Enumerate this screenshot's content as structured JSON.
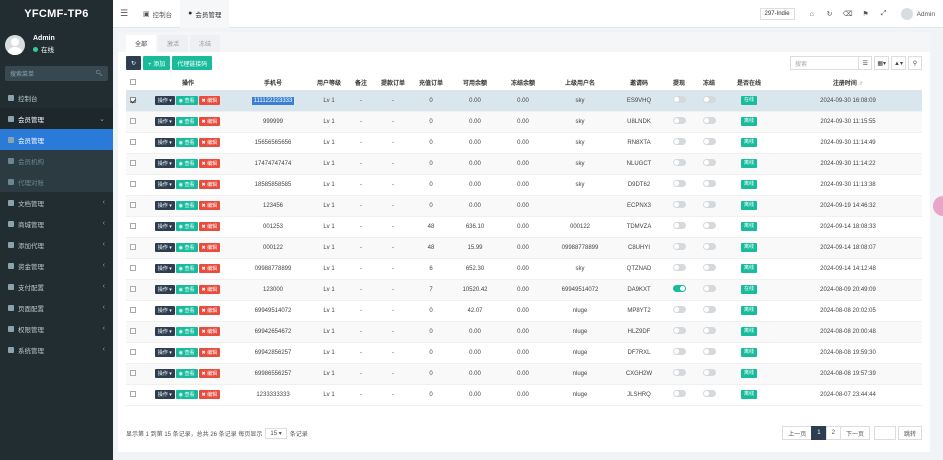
{
  "app": {
    "logo": "YFCMF-TP6"
  },
  "profile": {
    "name": "Admin",
    "status": "在线"
  },
  "sidebar": {
    "search_placeholder": "搜索菜单",
    "items": [
      {
        "label": "控制台",
        "state": "normal"
      },
      {
        "label": "会员管理",
        "state": "open"
      },
      {
        "label": "会员管理",
        "state": "active"
      },
      {
        "label": "会员机构",
        "state": "sub"
      },
      {
        "label": "代理对账",
        "state": "sub"
      },
      {
        "label": "文档管理",
        "state": "normal"
      },
      {
        "label": "商城管理",
        "state": "normal"
      },
      {
        "label": "添加代理",
        "state": "normal"
      },
      {
        "label": "资金管理",
        "state": "normal"
      },
      {
        "label": "支付配置",
        "state": "normal"
      },
      {
        "label": "页面配置",
        "state": "normal"
      },
      {
        "label": "权限管理",
        "state": "normal"
      },
      {
        "label": "系统管理",
        "state": "normal"
      }
    ]
  },
  "topbar": {
    "tabs": [
      {
        "label": "控制台"
      },
      {
        "label": "会员管理"
      }
    ],
    "badge": "297-Indie",
    "user": "Admin"
  },
  "subtabs": [
    "全部",
    "激活",
    "冻结"
  ],
  "toolbar": {
    "add": "+ 添加",
    "agent_code": "代理链接码",
    "search_placeholder": "搜索"
  },
  "table": {
    "columns": [
      "操作",
      "手机号",
      "用户等级",
      "备注",
      "提款订单",
      "充值订单",
      "可用余额",
      "冻结余额",
      "上级用户名",
      "邀请码",
      "提现",
      "冻结",
      "是否在线",
      "注册时间"
    ],
    "op_labels": {
      "menu": "操作",
      "edit": "查看",
      "del": "编辑"
    },
    "rows": [
      {
        "phone": "111122223333",
        "level": "Lv 1",
        "note": "-",
        "withdraw": "-",
        "recharge": "0",
        "balance": "0.00",
        "frozen": "0.00",
        "parent": "sky",
        "invite": "ES9VHQ",
        "wd_on": false,
        "fr_on": false,
        "online": "在线",
        "time": "2024-09-30 16:08:09",
        "checked": true,
        "highlight": true
      },
      {
        "phone": "999999",
        "level": "Lv 1",
        "note": "-",
        "withdraw": "-",
        "recharge": "0",
        "balance": "0.00",
        "frozen": "0.00",
        "parent": "sky",
        "invite": "U8LNDK",
        "wd_on": false,
        "fr_on": false,
        "online": "离线",
        "time": "2024-09-30 11:15:55"
      },
      {
        "phone": "15656565656",
        "level": "Lv 1",
        "note": "-",
        "withdraw": "-",
        "recharge": "0",
        "balance": "0.00",
        "frozen": "0.00",
        "parent": "sky",
        "invite": "RN8XTA",
        "wd_on": false,
        "fr_on": false,
        "online": "离线",
        "time": "2024-09-30 11:14:49"
      },
      {
        "phone": "17474747474",
        "level": "Lv 1",
        "note": "-",
        "withdraw": "-",
        "recharge": "0",
        "balance": "0.00",
        "frozen": "0.00",
        "parent": "sky",
        "invite": "NLUGCT",
        "wd_on": false,
        "fr_on": false,
        "online": "离线",
        "time": "2024-09-30 11:14:22"
      },
      {
        "phone": "18585858585",
        "level": "Lv 1",
        "note": "-",
        "withdraw": "-",
        "recharge": "0",
        "balance": "0.00",
        "frozen": "0.00",
        "parent": "sky",
        "invite": "D9DT62",
        "wd_on": false,
        "fr_on": false,
        "online": "离线",
        "time": "2024-09-30 11:13:38"
      },
      {
        "phone": "123456",
        "level": "Lv 1",
        "note": "-",
        "withdraw": "-",
        "recharge": "0",
        "balance": "0.00",
        "frozen": "0.00",
        "parent": "",
        "invite": "ECPNX3",
        "wd_on": false,
        "fr_on": false,
        "online": "离线",
        "time": "2024-09-19 14:46:32"
      },
      {
        "phone": "001253",
        "level": "Lv 1",
        "note": "-",
        "withdraw": "-",
        "recharge": "48",
        "balance": "636.10",
        "frozen": "0.00",
        "parent": "000122",
        "invite": "TDMVZA",
        "wd_on": false,
        "fr_on": false,
        "online": "离线",
        "time": "2024-09-14 18:08:33"
      },
      {
        "phone": "000122",
        "level": "Lv 1",
        "note": "-",
        "withdraw": "-",
        "recharge": "48",
        "balance": "15.99",
        "frozen": "0.00",
        "parent": "09988778899",
        "invite": "C8UHYI",
        "wd_on": false,
        "fr_on": false,
        "online": "离线",
        "time": "2024-09-14 18:08:07"
      },
      {
        "phone": "09988778899",
        "level": "Lv 1",
        "note": "-",
        "withdraw": "-",
        "recharge": "6",
        "balance": "652.30",
        "frozen": "0.00",
        "parent": "sky",
        "invite": "QTZNAD",
        "wd_on": false,
        "fr_on": false,
        "online": "离线",
        "time": "2024-09-14 14:12:48"
      },
      {
        "phone": "123000",
        "level": "Lv 1",
        "note": "-",
        "withdraw": "-",
        "recharge": "7",
        "balance": "10520.42",
        "frozen": "0.00",
        "parent": "69949514072",
        "invite": "DA9KXT",
        "wd_on": true,
        "fr_on": false,
        "online": "在线",
        "time": "2024-08-09 20:49:09"
      },
      {
        "phone": "69949514072",
        "level": "Lv 1",
        "note": "-",
        "withdraw": "-",
        "recharge": "0",
        "balance": "42.07",
        "frozen": "0.00",
        "parent": "nluge",
        "invite": "MP8YT2",
        "wd_on": false,
        "fr_on": false,
        "online": "离线",
        "time": "2024-08-08 20:02:05"
      },
      {
        "phone": "69942654672",
        "level": "Lv 1",
        "note": "-",
        "withdraw": "-",
        "recharge": "0",
        "balance": "0.00",
        "frozen": "0.00",
        "parent": "nluge",
        "invite": "HLZ9DF",
        "wd_on": false,
        "fr_on": false,
        "online": "离线",
        "time": "2024-08-08 20:00:48"
      },
      {
        "phone": "69942856257",
        "level": "Lv 1",
        "note": "-",
        "withdraw": "-",
        "recharge": "0",
        "balance": "0.00",
        "frozen": "0.00",
        "parent": "nluge",
        "invite": "DF7RXL",
        "wd_on": false,
        "fr_on": false,
        "online": "离线",
        "time": "2024-08-08 19:59:30"
      },
      {
        "phone": "69986556257",
        "level": "Lv 1",
        "note": "-",
        "withdraw": "-",
        "recharge": "0",
        "balance": "0.00",
        "frozen": "0.00",
        "parent": "nluge",
        "invite": "CXGH2W",
        "wd_on": false,
        "fr_on": false,
        "online": "离线",
        "time": "2024-08-08 19:57:39"
      },
      {
        "phone": "1233333333",
        "level": "Lv 1",
        "note": "-",
        "withdraw": "-",
        "recharge": "0",
        "balance": "0.00",
        "frozen": "0.00",
        "parent": "nluge",
        "invite": "JLSHRQ",
        "wd_on": false,
        "fr_on": false,
        "online": "离线",
        "time": "2024-08-07 23:44:44"
      }
    ]
  },
  "footer": {
    "summary_prefix": "显示第 1 到第 15 条记录，总共 26 条记录 每页显示",
    "page_size": "15",
    "summary_suffix": "条记录",
    "prev": "上一页",
    "pages": [
      "1",
      "2"
    ],
    "next": "下一页",
    "go": "跳转"
  }
}
